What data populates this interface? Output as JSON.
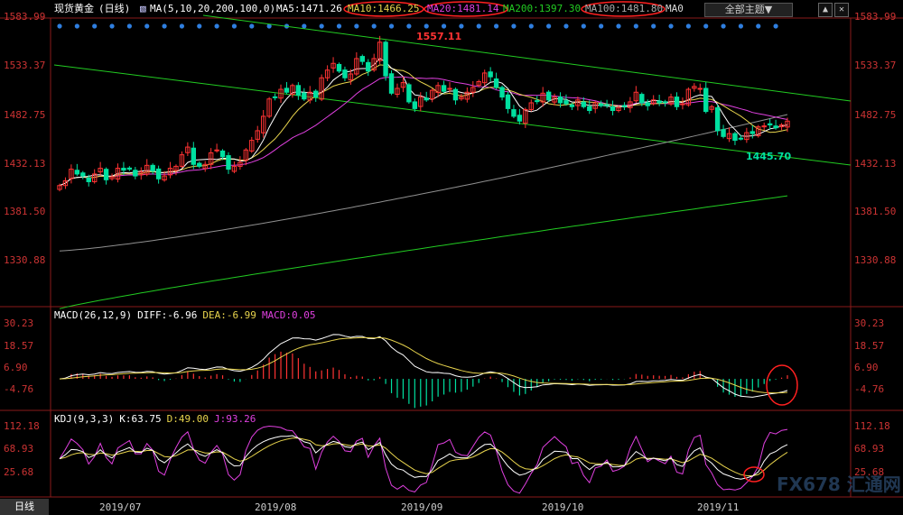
{
  "header": {
    "title": "现货黄金",
    "period": "(日线)",
    "ma_params": "MA(5,10,20,200,100,0)",
    "ma5": "MA5:1471.26",
    "ma10": "MA10:1466.25",
    "ma20": "MA20:1481.14",
    "ma200": "MA200:1397.30",
    "ma100": "MA100:1481.80",
    "ma0": "MA0",
    "theme_select": "全部主题",
    "theme_arrow": "▼"
  },
  "colors": {
    "up": "#ff3333",
    "down": "#00e0a0",
    "ma5": "#ffffff",
    "ma10": "#e8d44d",
    "ma20": "#e040e0",
    "ma100": "#909090",
    "ma200": "#22cc22",
    "channel": "#22cc22",
    "axis_text": "#cc3333",
    "ellipse": "#ff2020"
  },
  "price_panel": {
    "y_ticks": [
      "1583.99",
      "1533.37",
      "1482.75",
      "1432.13",
      "1381.50",
      "1330.88"
    ],
    "annotations": {
      "high": "1557.11",
      "low": "1445.70"
    }
  },
  "macd_panel": {
    "label": "MACD(26,12,9)",
    "diff": "DIFF:-6.96",
    "dea": "DEA:-6.99",
    "macd": "MACD:0.05",
    "y_ticks": [
      "30.23",
      "18.57",
      "6.90",
      "-4.76"
    ]
  },
  "kdj_panel": {
    "label": "KDJ(9,3,3)",
    "k": "K:63.75",
    "d": "D:49.00",
    "j": "J:93.26",
    "y_ticks": [
      "112.18",
      "68.93",
      "25.68"
    ]
  },
  "x_axis": [
    "2019/07",
    "2019/08",
    "2019/09",
    "2019/10",
    "2019/11"
  ],
  "period_tab": "日线",
  "watermark": "FX678 汇通网",
  "chart_data": {
    "type": "candlestick",
    "title": "现货黄金 日线",
    "ylim": [
      1330.88,
      1583.99
    ],
    "high_annotation": 1557.11,
    "low_annotation": 1445.7,
    "closes": [
      1408,
      1413,
      1425,
      1420,
      1418,
      1412,
      1420,
      1426,
      1414,
      1417,
      1426,
      1424,
      1425,
      1418,
      1422,
      1429,
      1423,
      1415,
      1418,
      1426,
      1428,
      1440,
      1448,
      1430,
      1428,
      1430,
      1442,
      1445,
      1438,
      1425,
      1428,
      1432,
      1445,
      1455,
      1465,
      1480,
      1498,
      1500,
      1508,
      1505,
      1512,
      1502,
      1498,
      1505,
      1500,
      1520,
      1528,
      1535,
      1527,
      1520,
      1524,
      1540,
      1537,
      1527,
      1540,
      1557,
      1522,
      1504,
      1509,
      1515,
      1495,
      1488,
      1500,
      1497,
      1507,
      1512,
      1506,
      1509,
      1497,
      1500,
      1505,
      1510,
      1516,
      1525,
      1521,
      1510,
      1500,
      1488,
      1480,
      1475,
      1487,
      1494,
      1496,
      1504,
      1497,
      1500,
      1494,
      1493,
      1490,
      1497,
      1490,
      1486,
      1494,
      1491,
      1492,
      1486,
      1489,
      1490,
      1495,
      1505,
      1494,
      1491,
      1497,
      1494,
      1495,
      1500,
      1490,
      1493,
      1508,
      1511,
      1509,
      1485,
      1490,
      1465,
      1459,
      1462,
      1455,
      1457,
      1463,
      1462,
      1469,
      1470,
      1471,
      1468,
      1471,
      1475
    ],
    "ma_values": {
      "MA5": 1471.26,
      "MA10": 1466.25,
      "MA20": 1481.14,
      "MA200": 1397.3,
      "MA100": 1481.8
    },
    "macd": {
      "DIFF": -6.96,
      "DEA": -6.99,
      "MACD": 0.05,
      "ylim": [
        -4.76,
        30.23
      ]
    },
    "kdj": {
      "K": 63.75,
      "D": 49.0,
      "J": 93.26,
      "ylim": [
        25.68,
        112.18
      ]
    },
    "x_labels": [
      "2019/07",
      "2019/08",
      "2019/09",
      "2019/10",
      "2019/11"
    ]
  }
}
